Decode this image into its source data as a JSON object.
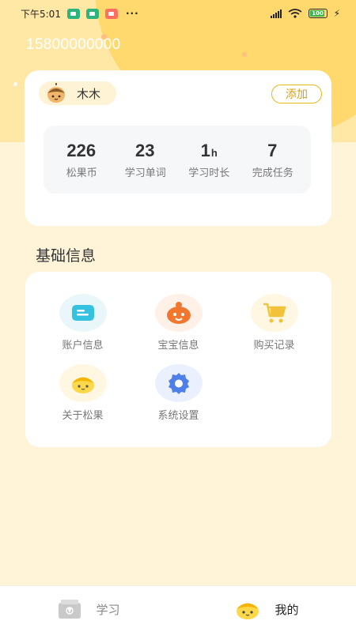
{
  "status_bar": {
    "time": "下午5:01",
    "more": "···",
    "battery": "100"
  },
  "header": {
    "phone": "15800000000"
  },
  "profile": {
    "name": "木木",
    "add_label": "添加",
    "stats": [
      {
        "value": "226",
        "unit": "",
        "label": "松果币"
      },
      {
        "value": "23",
        "unit": "",
        "label": "学习单词"
      },
      {
        "value": "1",
        "unit": "h",
        "label": "学习时长"
      },
      {
        "value": "7",
        "unit": "",
        "label": "完成任务"
      }
    ]
  },
  "section": {
    "title": "基础信息",
    "items": [
      {
        "label": "账户信息",
        "icon": "account-icon"
      },
      {
        "label": "宝宝信息",
        "icon": "baby-icon"
      },
      {
        "label": "购买记录",
        "icon": "cart-icon"
      },
      {
        "label": "关于松果",
        "icon": "acorn-icon"
      },
      {
        "label": "系统设置",
        "icon": "settings-icon"
      }
    ]
  },
  "tabbar": {
    "study_label": "学习",
    "mine_label": "我的"
  },
  "colors": {
    "accent": "#e9b51d",
    "background": "#fff4d8",
    "hero": "#ffd96d"
  }
}
